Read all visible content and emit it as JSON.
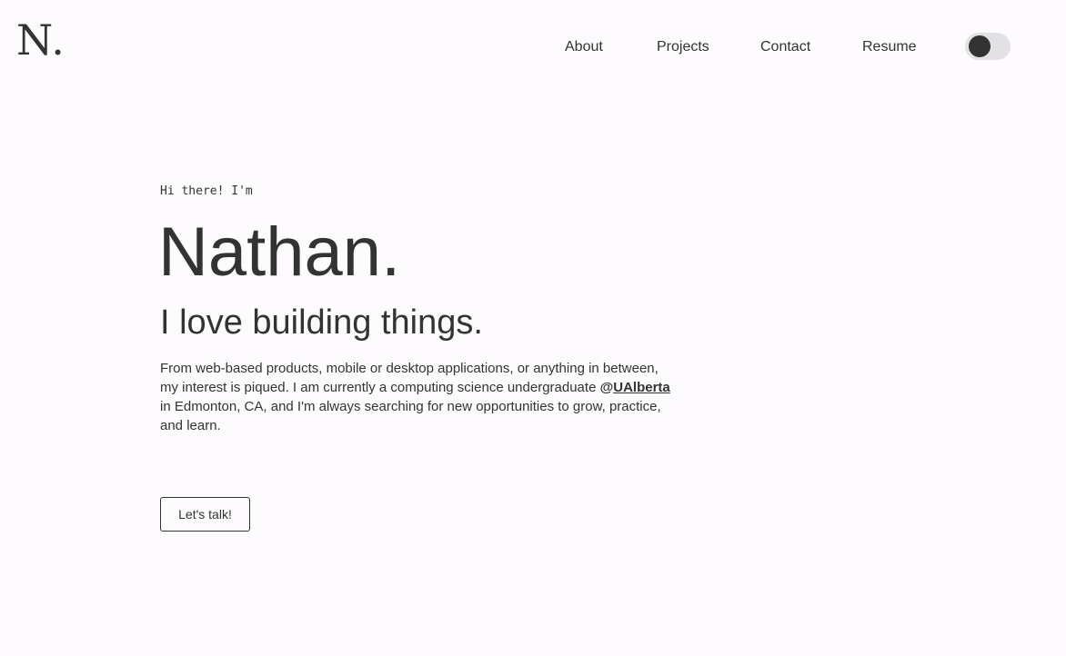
{
  "header": {
    "logo": "N.",
    "nav": {
      "about": "About",
      "projects": "Projects",
      "contact": "Contact",
      "resume": "Resume"
    }
  },
  "theme_toggle": {
    "state": "off"
  },
  "hero": {
    "greeting": "Hi there! I'm",
    "name": "Nathan.",
    "tagline": "I love building things.",
    "bio_part1": "From web-based products, mobile or desktop applications, or anything in between, my interest is piqued. I am currently a computing science undergraduate ",
    "bio_at": "@",
    "bio_link": "UAlberta",
    "bio_part2": " in Edmonton, CA, and I'm always searching for new opportunities to grow, practice, and learn.",
    "cta_label": "Let's talk!"
  },
  "colors": {
    "background": "#fdfbfe",
    "text": "#333333",
    "toggle_track": "#e3e1e4"
  }
}
